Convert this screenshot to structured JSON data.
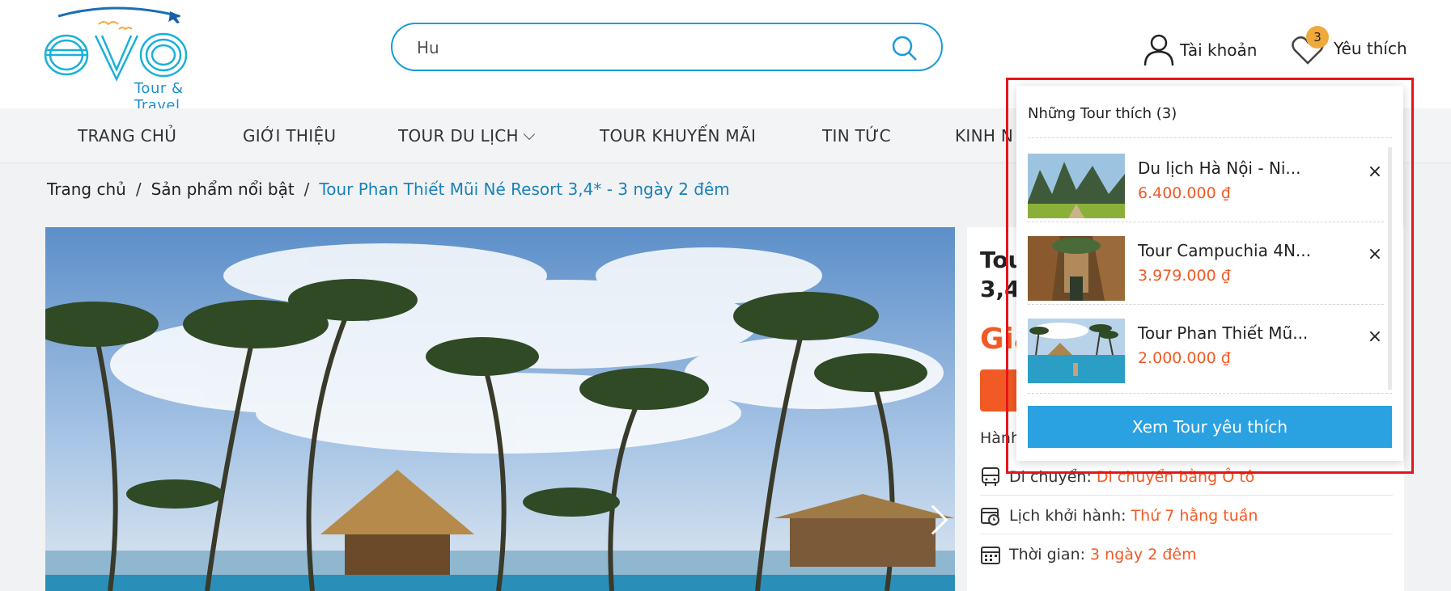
{
  "logo": {
    "text": "evo",
    "subtitle": "Tour & Travel"
  },
  "search": {
    "value": "Hu",
    "placeholder": ""
  },
  "header": {
    "account_label": "Tài khoản",
    "wishlist_label": "Yêu thích",
    "wishlist_count": "3"
  },
  "nav": [
    {
      "label": "TRANG CHỦ"
    },
    {
      "label": "GIỚI THIỆU"
    },
    {
      "label": "TOUR DU LỊCH"
    },
    {
      "label": "TOUR KHUYẾN MÃI"
    },
    {
      "label": "TIN TỨC"
    },
    {
      "label": "KINH N"
    }
  ],
  "breadcrumb": {
    "home": "Trang chủ",
    "category": "Sản phẩm nổi bật",
    "current": "Tour Phan Thiết Mũi Né Resort 3,4* - 3 ngày 2 đêm"
  },
  "info": {
    "title_line1": "Tou",
    "title_line2": "3,4",
    "price_prefix": "Giá",
    "hanh_label": "Hành",
    "transport_label": "Di chuyển:",
    "transport_value": "Di chuyển bằng Ô tô",
    "schedule_label": "Lịch khởi hành:",
    "schedule_value": "Thứ 7 hằng tuần",
    "duration_label": "Thời gian:",
    "duration_value": "3 ngày 2 đêm"
  },
  "wishlist_dropdown": {
    "title": "Những Tour thích (3)",
    "items": [
      {
        "name": "Du lịch Hà Nội - Ni...",
        "price": "6.400.000 ₫",
        "close": "×",
        "thumb": "mountain-landscape"
      },
      {
        "name": "Tour Campuchia 4N...",
        "price": "3.979.000 ₫",
        "close": "×",
        "thumb": "temple-ruins"
      },
      {
        "name": "Tour Phan Thiết Mũ...",
        "price": "2.000.000 ₫",
        "close": "×",
        "thumb": "resort-pool"
      }
    ],
    "button": "Xem Tour yêu thích"
  },
  "colors": {
    "accent_blue": "#2aa1e0",
    "price_orange": "#f15a24",
    "badge": "#f0a93b",
    "highlight_red": "#e8141b"
  }
}
